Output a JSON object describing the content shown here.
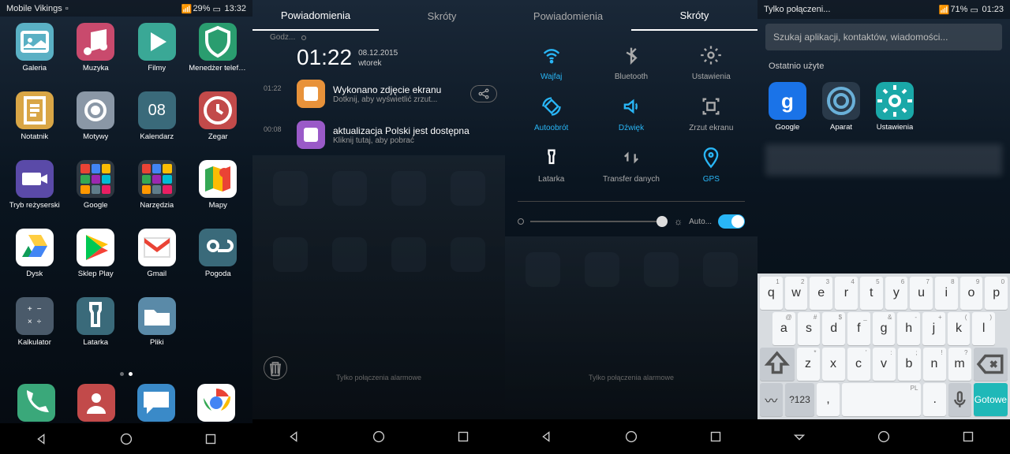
{
  "panel1": {
    "status": {
      "carrier": "Mobile Vikings",
      "battery": "29%",
      "time": "13:32"
    },
    "apps": [
      {
        "label": "Galeria",
        "bg": "#5ab0c4",
        "glyph": "image"
      },
      {
        "label": "Muzyka",
        "bg": "#c94a6d",
        "glyph": "music"
      },
      {
        "label": "Filmy",
        "bg": "#3aa896",
        "glyph": "play"
      },
      {
        "label": "Menedżer telefonu",
        "bg": "#2a9d6f",
        "glyph": "shield"
      },
      {
        "label": "Notatnik",
        "bg": "#d9a646",
        "glyph": "note"
      },
      {
        "label": "Motywy",
        "bg": "#8a97a6",
        "glyph": "theme"
      },
      {
        "label": "Kalendarz",
        "bg": "#3a6a7a",
        "glyph": "08"
      },
      {
        "label": "Zegar",
        "bg": "#c24a4a",
        "glyph": "clock"
      },
      {
        "label": "Tryb reżyserski",
        "bg": "#5a4aa8",
        "glyph": "video"
      },
      {
        "label": "Google",
        "bg": "folder",
        "glyph": "folder-g"
      },
      {
        "label": "Narzędzia",
        "bg": "folder",
        "glyph": "folder-t"
      },
      {
        "label": "Mapy",
        "bg": "#ffffff",
        "glyph": "maps"
      },
      {
        "label": "Dysk",
        "bg": "#ffffff",
        "glyph": "drive"
      },
      {
        "label": "Sklep Play",
        "bg": "#ffffff",
        "glyph": "playstore"
      },
      {
        "label": "Gmail",
        "bg": "#ffffff",
        "glyph": "gmail"
      },
      {
        "label": "Pogoda",
        "bg": "#3a6a7a",
        "glyph": "weather"
      },
      {
        "label": "Kalkulator",
        "bg": "#4a5a6a",
        "glyph": "calc"
      },
      {
        "label": "Latarka",
        "bg": "#3a6a7a",
        "glyph": "torch"
      },
      {
        "label": "Pliki",
        "bg": "#5a8aa8",
        "glyph": "folder"
      }
    ],
    "dock": [
      {
        "name": "phone",
        "bg": "#3aa87a",
        "glyph": "phone"
      },
      {
        "name": "contacts",
        "bg": "#c24a4a",
        "glyph": "contacts"
      },
      {
        "name": "messages",
        "bg": "#3a8ac8",
        "glyph": "chat"
      },
      {
        "name": "chrome",
        "bg": "#ffffff",
        "glyph": "chrome"
      }
    ]
  },
  "panel2": {
    "tabs": {
      "left": "Powiadomienia",
      "right": "Skróty"
    },
    "today_label": "Godz...",
    "time": "01:22",
    "date": "08.12.2015",
    "day": "wtorek",
    "notifs": [
      {
        "time": "01:22",
        "title": "Wykonano zdjęcie ekranu",
        "sub": "Dotknij, aby wyświetlić zrzut...",
        "icon_bg": "#e8923a",
        "share": true
      },
      {
        "time": "00:08",
        "title": "aktualizacja Polski jest dostępna",
        "sub": "Kliknij tutaj, aby pobrać",
        "icon_bg": "#9a5ac8"
      }
    ],
    "footer": "Tylko połączenia alarmowe"
  },
  "panel3": {
    "tabs": {
      "left": "Powiadomienia",
      "right": "Skróty"
    },
    "tiles": [
      {
        "label": "Wajfaj",
        "on": true,
        "glyph": "wifi"
      },
      {
        "label": "Bluetooth",
        "on": false,
        "glyph": "bt"
      },
      {
        "label": "Ustawienia",
        "on": false,
        "glyph": "gear"
      },
      {
        "label": "Autoobrót",
        "on": true,
        "glyph": "rotate"
      },
      {
        "label": "Dźwięk",
        "on": true,
        "glyph": "sound"
      },
      {
        "label": "Zrzut ekranu",
        "on": false,
        "glyph": "screenshot"
      },
      {
        "label": "Latarka",
        "on": false,
        "glyph": "torch"
      },
      {
        "label": "Transfer danych",
        "on": false,
        "glyph": "data"
      },
      {
        "label": "GPS",
        "on": true,
        "glyph": "gps"
      }
    ],
    "auto_label": "Auto...",
    "footer": "Tylko połączenia alarmowe"
  },
  "panel4": {
    "status": {
      "left": "Tylko połączeni...",
      "battery": "71%",
      "time": "01:23"
    },
    "search_placeholder": "Szukaj aplikacji, kontaktów, wiadomości...",
    "section": "Ostatnio użyte",
    "recent": [
      {
        "label": "Google",
        "bg": "#1a73e8",
        "glyph": "g"
      },
      {
        "label": "Aparat",
        "bg": "#2a3a4a",
        "glyph": "camera"
      },
      {
        "label": "Ustawienia",
        "bg": "#1aa8a8",
        "glyph": "gear"
      }
    ],
    "kbd": {
      "r1": [
        [
          "q",
          "1"
        ],
        [
          "w",
          "2"
        ],
        [
          "e",
          "3"
        ],
        [
          "r",
          "4"
        ],
        [
          "t",
          "5"
        ],
        [
          "y",
          "6"
        ],
        [
          "u",
          "7"
        ],
        [
          "i",
          "8"
        ],
        [
          "o",
          "9"
        ],
        [
          "p",
          "0"
        ]
      ],
      "r2": [
        [
          "a",
          "@"
        ],
        [
          "s",
          "#"
        ],
        [
          "d",
          "$"
        ],
        [
          "f",
          "_"
        ],
        [
          "g",
          "&"
        ],
        [
          "h",
          "-"
        ],
        [
          "j",
          "+"
        ],
        [
          "k",
          "("
        ],
        [
          "l",
          ")"
        ]
      ],
      "r3": [
        [
          "z",
          "*"
        ],
        [
          "x",
          ""
        ],
        [
          "c",
          "'"
        ],
        [
          "v",
          ":"
        ],
        [
          "b",
          ";"
        ],
        [
          "n",
          "!"
        ],
        [
          "m",
          "?"
        ]
      ],
      "sym": "?123",
      "done": "Gotowe",
      "lang": "PL"
    }
  }
}
